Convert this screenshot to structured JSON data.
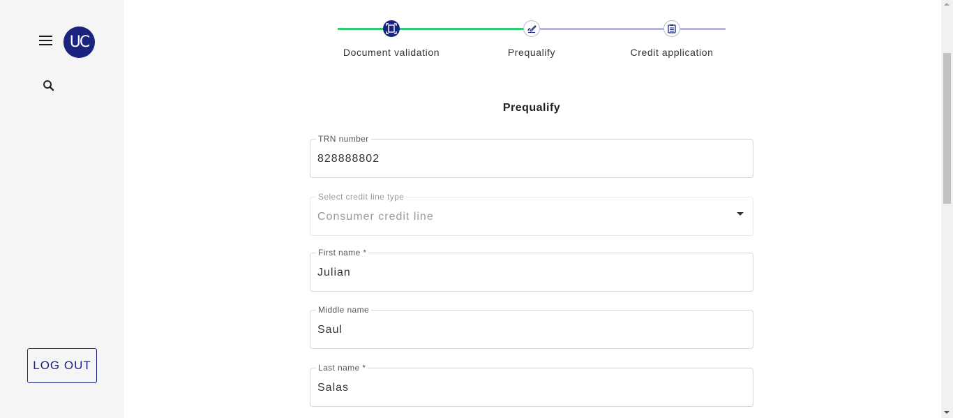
{
  "user": {
    "initials": "UC"
  },
  "sidebar": {
    "menu_icon": "hamburger-menu-icon",
    "search_icon": "search-icon",
    "logout_label": "LOG OUT"
  },
  "stepper": {
    "colors": {
      "complete": "#2ecc71",
      "pending": "#b7b8d6",
      "active": "#1a237e"
    },
    "steps": [
      {
        "label": "Document validation",
        "icon": "document-scan-icon",
        "status": "complete"
      },
      {
        "label": "Prequalify",
        "icon": "signature-icon",
        "status": "current"
      },
      {
        "label": "Credit application",
        "icon": "clipboard-list-icon",
        "status": "pending"
      }
    ]
  },
  "form": {
    "title": "Prequalify",
    "fields": [
      {
        "label": "TRN number",
        "value": "828888802"
      },
      {
        "label": "Select credit line type",
        "value": "Consumer credit line",
        "disabled": true,
        "type": "select"
      },
      {
        "label": "First name *",
        "value": "Julian"
      },
      {
        "label": "Middle name",
        "value": "Saul"
      },
      {
        "label": "Last name *",
        "value": "Salas"
      }
    ]
  }
}
